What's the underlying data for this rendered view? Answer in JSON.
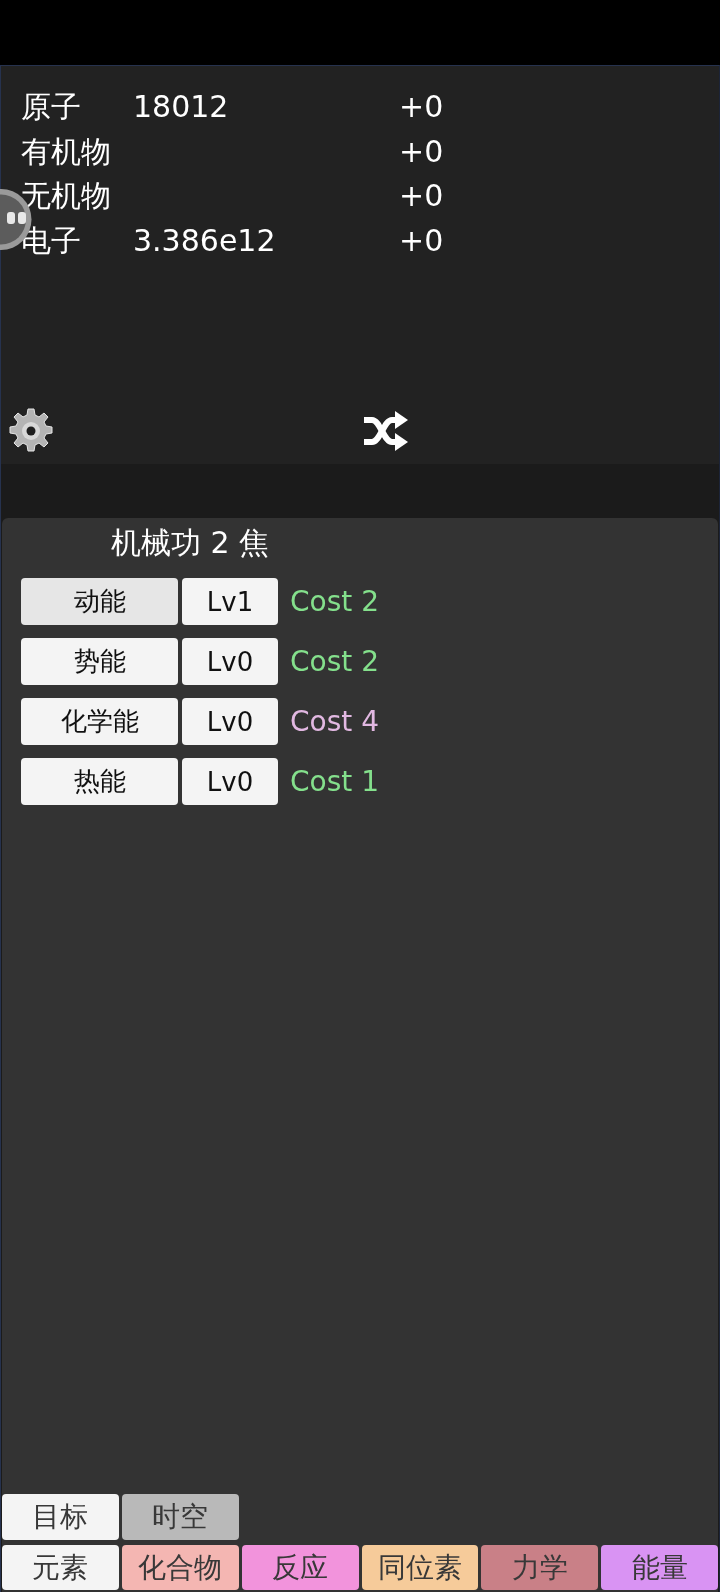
{
  "resources": [
    {
      "name": "原子",
      "value": "18012",
      "delta": "+0"
    },
    {
      "name": "有机物",
      "delta": "+0"
    },
    {
      "name": "无机物",
      "delta": "+0"
    },
    {
      "name": "电子",
      "value": "3.386e12",
      "delta": "+0"
    }
  ],
  "panel": {
    "title": "机械功 2 焦",
    "upgrades": [
      {
        "label": "动能",
        "pressed": true,
        "level": "Lv1",
        "cost": "Cost 2",
        "affordable": true
      },
      {
        "label": "势能",
        "pressed": false,
        "level": "Lv0",
        "cost": "Cost 2",
        "affordable": true
      },
      {
        "label": "化学能",
        "pressed": false,
        "level": "Lv0",
        "cost": "Cost 4",
        "affordable": false
      },
      {
        "label": "热能",
        "pressed": false,
        "level": "Lv0",
        "cost": "Cost 1",
        "affordable": true
      }
    ]
  },
  "tab_rows": [
    {
      "tabs": [
        {
          "label": "目标",
          "color": "#f4f4f4"
        },
        {
          "label": "时空",
          "color": "#b9b9b9"
        }
      ]
    },
    {
      "tabs": [
        {
          "label": "元素",
          "color": "#f4f4f4"
        },
        {
          "label": "化合物",
          "color": "#f4b6b2"
        },
        {
          "label": "反应",
          "color": "#f293dc"
        },
        {
          "label": "同位素",
          "color": "#f6cb9a"
        },
        {
          "label": "力学",
          "color": "#c98087"
        },
        {
          "label": "能量",
          "color": "#d993f3"
        }
      ]
    }
  ]
}
